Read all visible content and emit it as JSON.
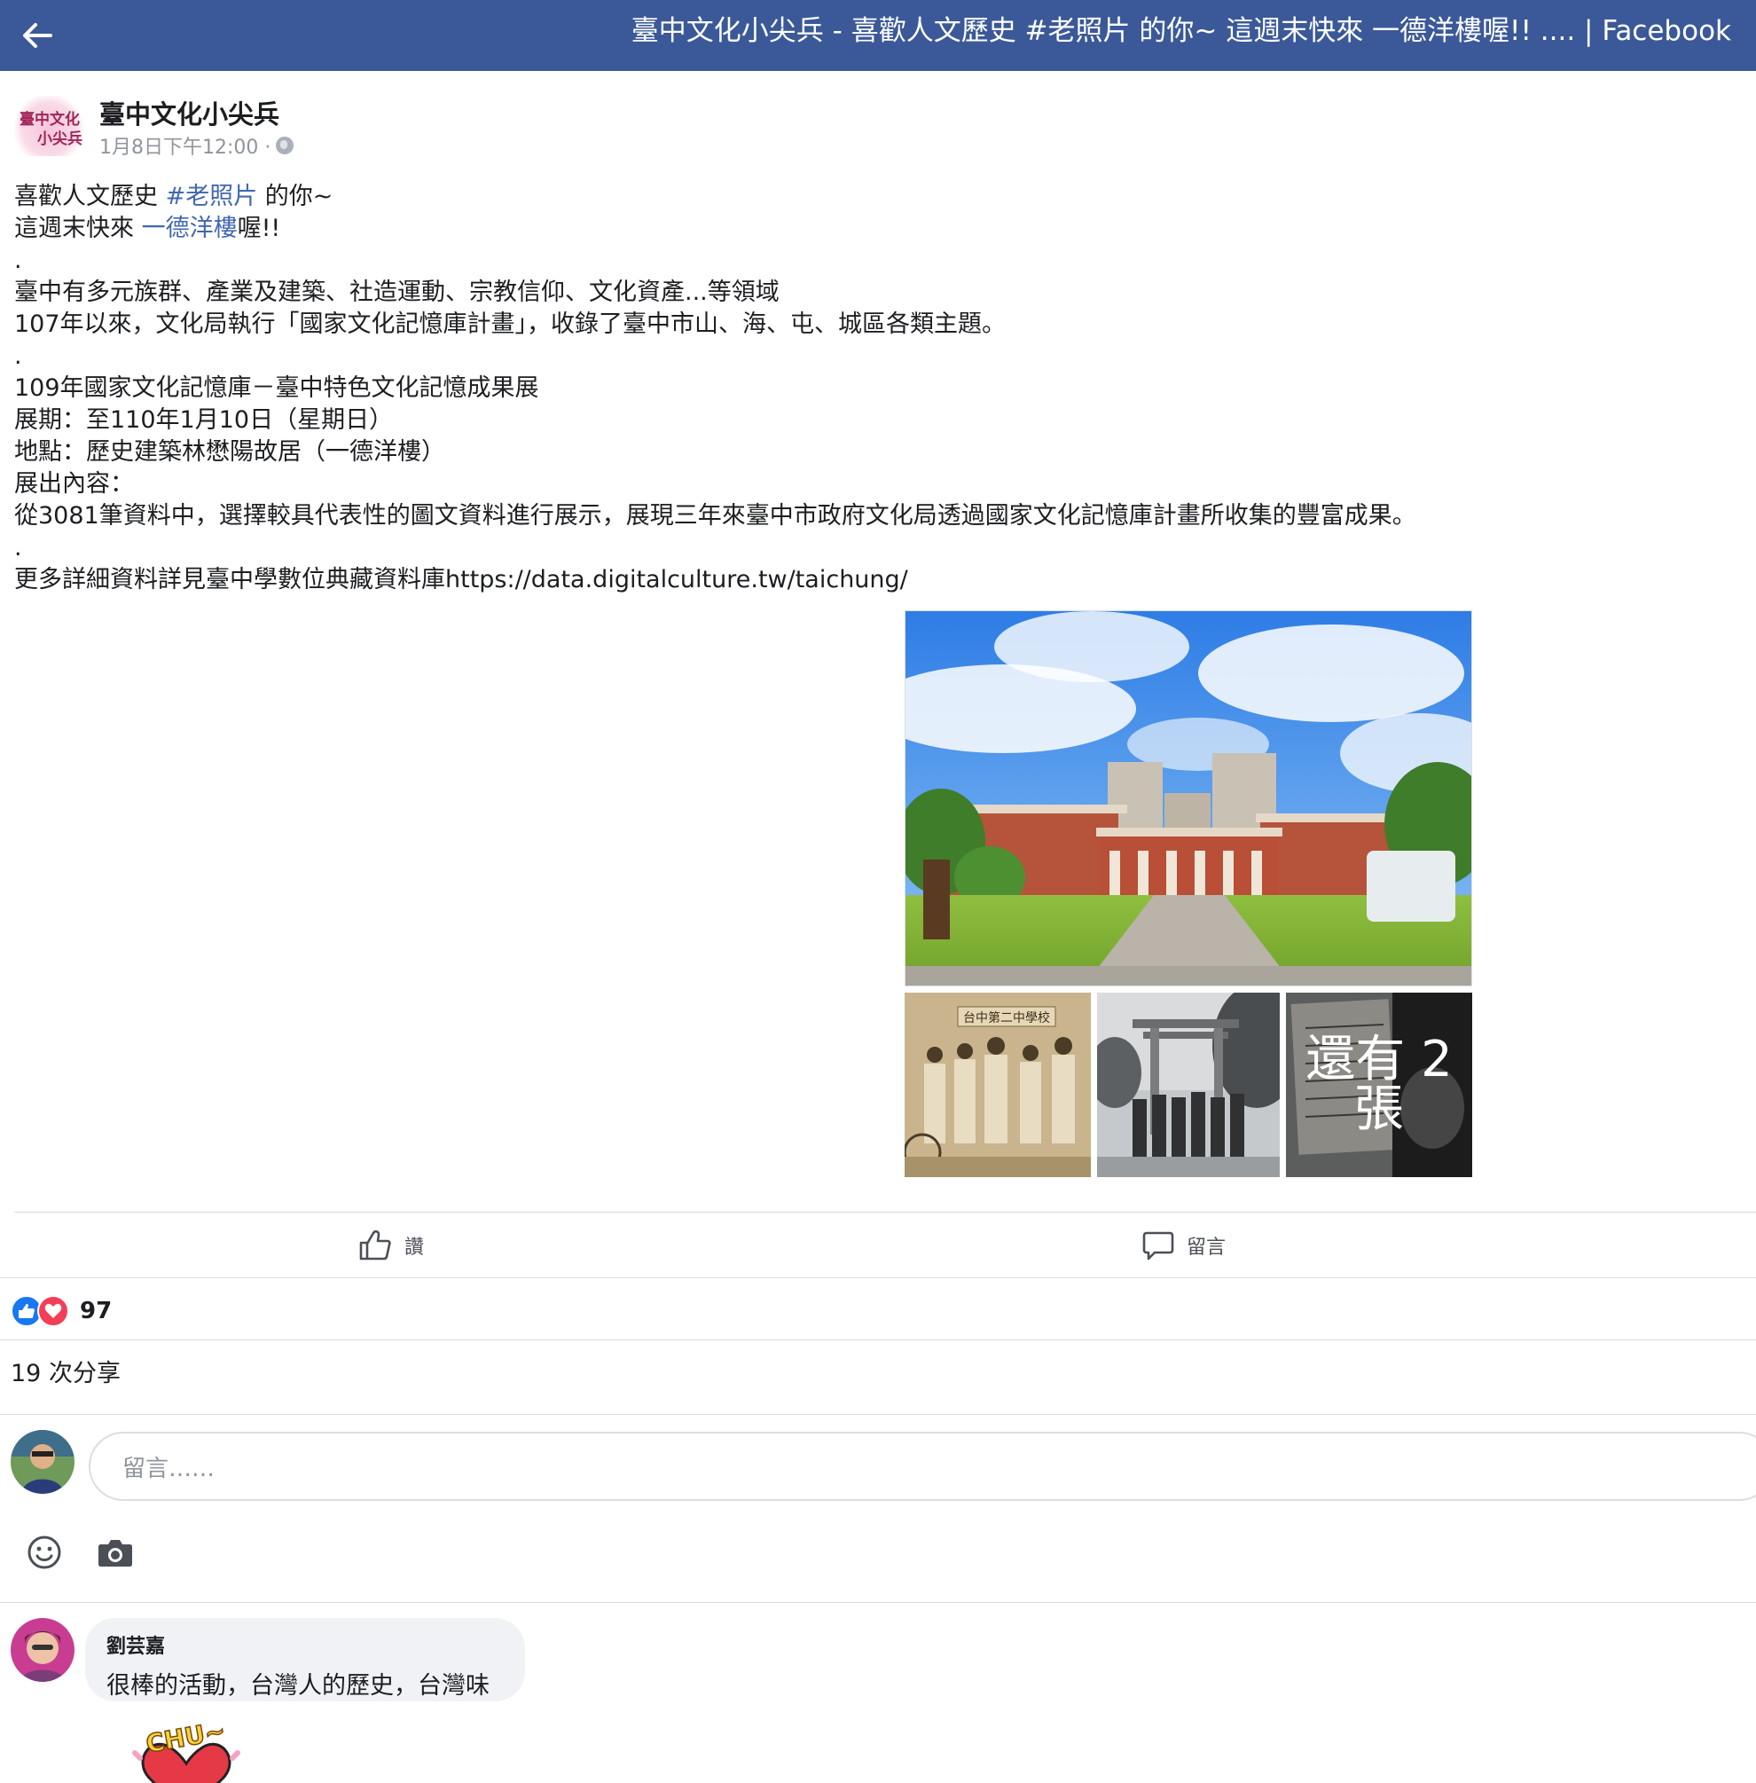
{
  "topbar": {
    "title": "臺中文化小尖兵 - 喜歡人文歷史 #老照片 的你~ 這週末快來 一德洋樓喔!! .... | Facebook",
    "back_icon": "back-arrow-icon",
    "color": "#3b5998"
  },
  "post": {
    "page_name": "臺中文化小尖兵",
    "avatar_text": {
      "line1": "臺中文化",
      "line2": "小尖兵"
    },
    "timestamp": "1月8日下午12:00 ·",
    "body": {
      "l1_a": "喜歡人文歷史 ",
      "l1_hashtag": "#老照片",
      "l1_b": " 的你~",
      "l2_a": "這週末快來 ",
      "l2_link": "一德洋樓",
      "l2_b": "喔!!",
      "l3": ".",
      "l4": "臺中有多元族群、產業及建築、社造運動、宗教信仰、文化資產...等領域",
      "l5": "107年以來，文化局執行「國家文化記憶庫計畫」，收錄了臺中市山、海、屯、城區各類主題。",
      "l6": ".",
      "l7": "109年國家文化記憶庫－臺中特色文化記憶成果展",
      "l8": "展期：至110年1月10日（星期日）",
      "l9": "地點：歷史建築林懋陽故居（一德洋樓）",
      "l10": "展出內容：",
      "l11": "從3081筆資料中，選擇較具代表性的圖文資料進行展示，展現三年來臺中市政府文化局透過國家文化記憶庫計畫所收集的豐富成果。",
      "l12": ".",
      "l13": "更多詳細資料詳見臺中學數位典藏資料庫https://data.digitalculture.tw/taichung/"
    },
    "photos": {
      "thumb1_sign": "台中第二中學校",
      "more_label": "還有 2 張"
    }
  },
  "actions": {
    "like_label": "讚",
    "comment_label": "留言"
  },
  "reactions": {
    "count": "97",
    "shares": "19 次分享"
  },
  "composer": {
    "placeholder": "留言……"
  },
  "comments": [
    {
      "author": "劉芸嘉",
      "text": "很棒的活動，台灣人的歷史，台灣味",
      "sticker_text": "CHU~"
    }
  ]
}
